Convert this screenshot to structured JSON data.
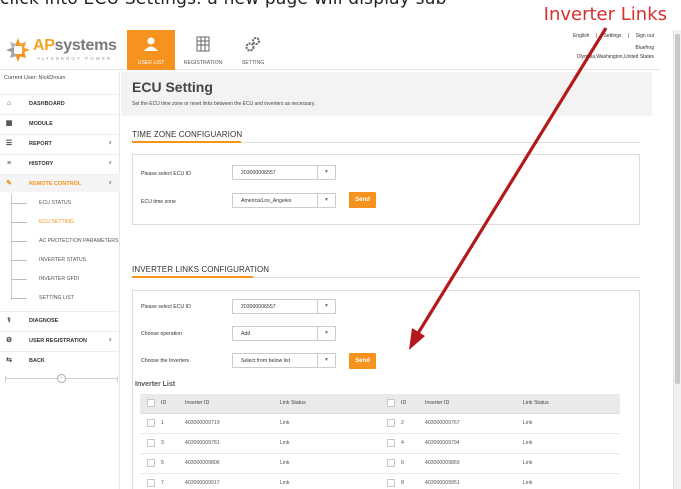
{
  "caption": {
    "cut_text": "click into ECU Settings. a new page will display sub",
    "annotation_label": "Inverter Links",
    "annotation_color": "#d9302f"
  },
  "brand": {
    "name_ap": "AP",
    "name_rest": "systems",
    "tagline": "ALTENERGY POWER",
    "accent": "#f6921e"
  },
  "nav": {
    "tabs": [
      {
        "label": "USER LIST",
        "icon": "user-icon",
        "active": true
      },
      {
        "label": "REGISTRATION",
        "icon": "registration-grid-icon",
        "active": false
      },
      {
        "label": "SETTING",
        "icon": "gears-icon",
        "active": false
      }
    ]
  },
  "header_right": {
    "links": [
      "English",
      "|",
      "Settings",
      "|",
      "Sign out"
    ],
    "user_name": "Bluefrog",
    "location": "Olympia,Washington,United States"
  },
  "sidebar": {
    "current_user": "Current User: NickDrouin",
    "items": [
      {
        "label": "DASHBOARD",
        "icon": "home-icon",
        "chevron": false,
        "active": false
      },
      {
        "label": "MODULE",
        "icon": "grid-icon",
        "chevron": false,
        "active": false
      },
      {
        "label": "REPORT",
        "icon": "report-icon",
        "chevron": true,
        "active": false
      },
      {
        "label": "HISTORY",
        "icon": "database-icon",
        "chevron": true,
        "active": false
      },
      {
        "label": "REMOTE CONTROL",
        "icon": "wrench-icon",
        "chevron": true,
        "active": true
      }
    ],
    "sub_items": [
      {
        "label": "ECU STATUS",
        "active": false
      },
      {
        "label": "ECU SETTING",
        "active": true
      },
      {
        "label": "AC PROTECTION PARAMETERS",
        "active": false
      },
      {
        "label": "INVERTER STATUS",
        "active": false
      },
      {
        "label": "INVERTER GFDI",
        "active": false
      },
      {
        "label": "SETTING LIST",
        "active": false
      }
    ],
    "items_after": [
      {
        "label": "DIAGNOSE",
        "icon": "stethoscope-icon",
        "chevron": false
      },
      {
        "label": "USER REGISTRATION",
        "icon": "user-gear-icon",
        "chevron": true
      },
      {
        "label": "BACK",
        "icon": "back-arrows-icon",
        "chevron": false
      }
    ],
    "collapse_glyph": "‹"
  },
  "page": {
    "title": "ECU Setting",
    "subtitle": "Set the ECU time zone or reset links between the ECU and inverters as necessary."
  },
  "timezone_section": {
    "title": "TIME ZONE CONFIGUARION",
    "ecu_label": "Please select ECU ID",
    "ecu_value": "203000006557",
    "tz_label": "ECU time zone",
    "tz_value": "America/Los_Angeles",
    "send_label": "Send"
  },
  "links_section": {
    "title": "INVERTER LINKS CONFIGURATION",
    "ecu_label": "Please select ECU ID",
    "ecu_value": "203000006557",
    "op_label": "Choose operation",
    "op_value": "Add",
    "inv_label": "Choose the Inverters",
    "inv_value": "Select from below list",
    "send_label": "Send",
    "list_title": "Inverter List",
    "columns": [
      "ID",
      "Inverter ID",
      "Link Status",
      "ID",
      "Inverter ID",
      "Link Status"
    ],
    "rows": [
      [
        {
          "id": "1",
          "inv": "403000009719",
          "status": "Link"
        },
        {
          "id": "2",
          "inv": "403000009767",
          "status": "Link"
        }
      ],
      [
        {
          "id": "3",
          "inv": "403000009781",
          "status": "Link"
        },
        {
          "id": "4",
          "inv": "403000009794",
          "status": "Link"
        }
      ],
      [
        {
          "id": "5",
          "inv": "403000009806",
          "status": "Link"
        },
        {
          "id": "6",
          "inv": "403000009869",
          "status": "Link"
        }
      ],
      [
        {
          "id": "7",
          "inv": "403000009917",
          "status": "Link"
        },
        {
          "id": "8",
          "inv": "403000009951",
          "status": "Link"
        }
      ]
    ]
  }
}
